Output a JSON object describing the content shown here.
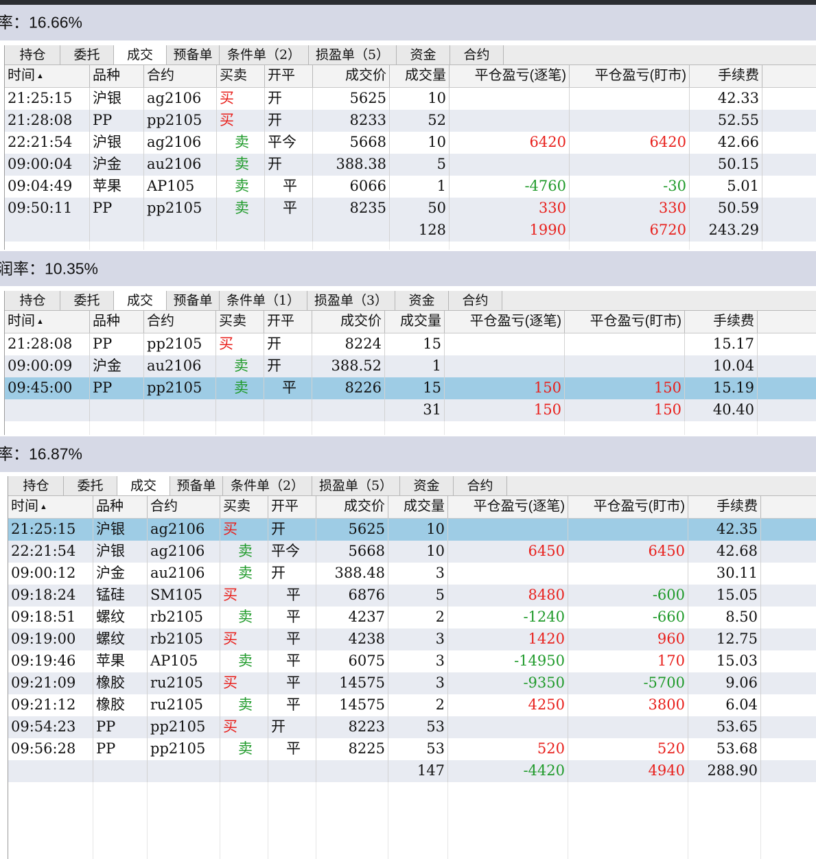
{
  "panels": [
    {
      "header": "率：16.66%",
      "tabs": [
        "持仓",
        "委托",
        "成交",
        "预备单",
        "条件单（2）",
        "损盈单（5）",
        "资金",
        "合约"
      ],
      "active_tab": 2,
      "columns": [
        "时间",
        "品种",
        "合约",
        "买卖",
        "开平",
        "成交价",
        "成交量",
        "平仓盈亏(逐笔)",
        "平仓盈亏(盯市)",
        "手续费"
      ],
      "sort_indicator": "▲",
      "selected_row": -1,
      "rows": [
        {
          "time": "21:25:15",
          "product": "沪银",
          "contract": "ag2106",
          "side": "买",
          "offset": "开",
          "price": "5625",
          "qty": "10",
          "pnl_trade": "",
          "pnl_mark": "",
          "fee": "42.33"
        },
        {
          "time": "21:28:08",
          "product": "PP",
          "contract": "pp2105",
          "side": "买",
          "offset": "开",
          "price": "8233",
          "qty": "52",
          "pnl_trade": "",
          "pnl_mark": "",
          "fee": "52.55"
        },
        {
          "time": "22:21:54",
          "product": "沪银",
          "contract": "ag2106",
          "side": "卖",
          "offset": "平今",
          "price": "5668",
          "qty": "10",
          "pnl_trade": "6420",
          "pnl_mark": "6420",
          "fee": "42.66"
        },
        {
          "time": "09:00:04",
          "product": "沪金",
          "contract": "au2106",
          "side": "卖",
          "offset": "开",
          "price": "388.38",
          "qty": "5",
          "pnl_trade": "",
          "pnl_mark": "",
          "fee": "50.15"
        },
        {
          "time": "09:04:49",
          "product": "苹果",
          "contract": "AP105",
          "side": "卖",
          "offset": "平",
          "price": "6066",
          "qty": "1",
          "pnl_trade": "-4760",
          "pnl_mark": "-30",
          "fee": "5.01"
        },
        {
          "time": "09:50:11",
          "product": "PP",
          "contract": "pp2105",
          "side": "卖",
          "offset": "平",
          "price": "8235",
          "qty": "50",
          "pnl_trade": "330",
          "pnl_mark": "330",
          "fee": "50.59"
        }
      ],
      "total": {
        "qty": "128",
        "pnl_trade": "1990",
        "pnl_mark": "6720",
        "fee": "243.29"
      }
    },
    {
      "header": "润率：10.35%",
      "tabs": [
        "持仓",
        "委托",
        "成交",
        "预备单",
        "条件单（1）",
        "损盈单（3）",
        "资金",
        "合约"
      ],
      "active_tab": 2,
      "columns": [
        "时间",
        "品种",
        "合约",
        "买卖",
        "开平",
        "成交价",
        "成交量",
        "平仓盈亏(逐笔)",
        "平仓盈亏(盯市)",
        "手续费"
      ],
      "sort_indicator": "▲",
      "selected_row": 2,
      "rows": [
        {
          "time": "21:28:08",
          "product": "PP",
          "contract": "pp2105",
          "side": "买",
          "offset": "开",
          "price": "8224",
          "qty": "15",
          "pnl_trade": "",
          "pnl_mark": "",
          "fee": "15.17"
        },
        {
          "time": "09:00:09",
          "product": "沪金",
          "contract": "au2106",
          "side": "卖",
          "offset": "开",
          "price": "388.52",
          "qty": "1",
          "pnl_trade": "",
          "pnl_mark": "",
          "fee": "10.04"
        },
        {
          "time": "09:45:00",
          "product": "PP",
          "contract": "pp2105",
          "side": "卖",
          "offset": "平",
          "price": "8226",
          "qty": "15",
          "pnl_trade": "150",
          "pnl_mark": "150",
          "fee": "15.19"
        }
      ],
      "total": {
        "qty": "31",
        "pnl_trade": "150",
        "pnl_mark": "150",
        "fee": "40.40"
      }
    },
    {
      "header": "率：16.87%",
      "tabs": [
        "持仓",
        "委托",
        "成交",
        "预备单",
        "条件单（2）",
        "损盈单（5）",
        "资金",
        "合约"
      ],
      "active_tab": 2,
      "columns": [
        "时间",
        "品种",
        "合约",
        "买卖",
        "开平",
        "成交价",
        "成交量",
        "平仓盈亏(逐笔)",
        "平仓盈亏(盯市)",
        "手续费"
      ],
      "sort_indicator": "▲",
      "selected_row": 0,
      "rows": [
        {
          "time": "21:25:15",
          "product": "沪银",
          "contract": "ag2106",
          "side": "买",
          "offset": "开",
          "price": "5625",
          "qty": "10",
          "pnl_trade": "",
          "pnl_mark": "",
          "fee": "42.35"
        },
        {
          "time": "22:21:54",
          "product": "沪银",
          "contract": "ag2106",
          "side": "卖",
          "offset": "平今",
          "price": "5668",
          "qty": "10",
          "pnl_trade": "6450",
          "pnl_mark": "6450",
          "fee": "42.68"
        },
        {
          "time": "09:00:12",
          "product": "沪金",
          "contract": "au2106",
          "side": "卖",
          "offset": "开",
          "price": "388.48",
          "qty": "3",
          "pnl_trade": "",
          "pnl_mark": "",
          "fee": "30.11"
        },
        {
          "time": "09:18:24",
          "product": "锰硅",
          "contract": "SM105",
          "side": "买",
          "offset": "平",
          "price": "6876",
          "qty": "5",
          "pnl_trade": "8480",
          "pnl_mark": "-600",
          "fee": "15.05"
        },
        {
          "time": "09:18:51",
          "product": "螺纹",
          "contract": "rb2105",
          "side": "卖",
          "offset": "平",
          "price": "4237",
          "qty": "2",
          "pnl_trade": "-1240",
          "pnl_mark": "-660",
          "fee": "8.50"
        },
        {
          "time": "09:19:00",
          "product": "螺纹",
          "contract": "rb2105",
          "side": "买",
          "offset": "平",
          "price": "4238",
          "qty": "3",
          "pnl_trade": "1420",
          "pnl_mark": "960",
          "fee": "12.75"
        },
        {
          "time": "09:19:46",
          "product": "苹果",
          "contract": "AP105",
          "side": "卖",
          "offset": "平",
          "price": "6075",
          "qty": "3",
          "pnl_trade": "-14950",
          "pnl_mark": "170",
          "fee": "15.03"
        },
        {
          "time": "09:21:09",
          "product": "橡胶",
          "contract": "ru2105",
          "side": "买",
          "offset": "平",
          "price": "14575",
          "qty": "3",
          "pnl_trade": "-9350",
          "pnl_mark": "-5700",
          "fee": "9.06"
        },
        {
          "time": "09:21:12",
          "product": "橡胶",
          "contract": "ru2105",
          "side": "卖",
          "offset": "平",
          "price": "14575",
          "qty": "2",
          "pnl_trade": "4250",
          "pnl_mark": "3800",
          "fee": "6.04"
        },
        {
          "time": "09:54:23",
          "product": "PP",
          "contract": "pp2105",
          "side": "买",
          "offset": "开",
          "price": "8223",
          "qty": "53",
          "pnl_trade": "",
          "pnl_mark": "",
          "fee": "53.65"
        },
        {
          "time": "09:56:28",
          "product": "PP",
          "contract": "pp2105",
          "side": "卖",
          "offset": "平",
          "price": "8225",
          "qty": "53",
          "pnl_trade": "520",
          "pnl_mark": "520",
          "fee": "53.68"
        }
      ],
      "total": {
        "qty": "147",
        "pnl_trade": "-4420",
        "pnl_mark": "4940",
        "fee": "288.90"
      }
    }
  ],
  "colors": {
    "profit": "#e8201c",
    "loss": "#1f9a2a",
    "buy": "#e8201c",
    "sell": "#1f9a2a",
    "selected": "#9ecce5",
    "header_band": "#d6d9e6"
  }
}
